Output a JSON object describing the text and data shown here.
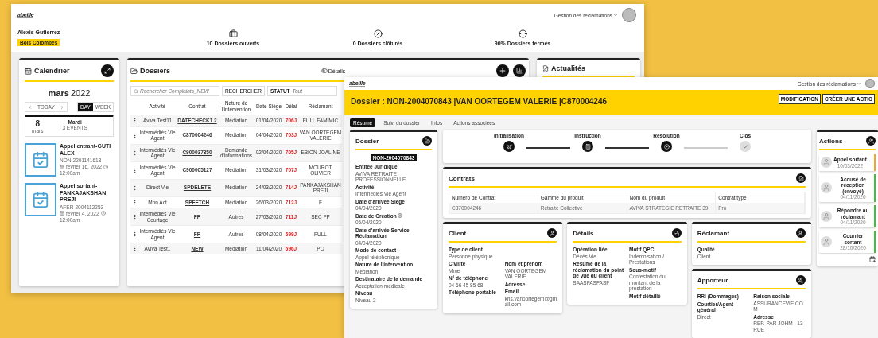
{
  "back_window": {
    "logo": "abeille",
    "menu": "Gestion des réclamations",
    "user": {
      "name": "Alexis Gutierrez",
      "site": "Bois Colombes"
    },
    "stats": [
      {
        "kind": "open",
        "text": "10 Dossiers ouverts"
      },
      {
        "kind": "closed",
        "text": "0 Dossiers",
        "note": "clôturés"
      },
      {
        "kind": "rate",
        "text": "90% Dossiers fermés"
      }
    ],
    "calendar": {
      "title": "Calendrier",
      "month": "mars",
      "year": "2022",
      "today": "TODAY",
      "views": [
        {
          "label": "DAY",
          "selected": true
        },
        {
          "label": "WEEK",
          "selected": false
        }
      ],
      "day": {
        "number": "8",
        "month": "mars",
        "weekday": "Mardi",
        "events": "3 EVENTS"
      },
      "events": [
        {
          "title": "Appel entrant-GUTI ALEX",
          "ref": "NON-2201141618",
          "date": "février 16, 2022",
          "time": "12:00am"
        },
        {
          "title": "Appel sortant-PANKAJAKSHAN PREJI",
          "ref": "AFER-2004112253",
          "date": "février 4, 2022",
          "time": "12:00am"
        }
      ]
    },
    "dossiers": {
      "title": "Dossiers",
      "toggle": "Détails",
      "search_placeholder": "Rechercher Complaints_NEW",
      "search_button": "RECHERCHER",
      "status": {
        "label": "STATUT",
        "placeholder": "Tout"
      },
      "columns": [
        {
          "label": "Activité",
          "kind": "text"
        },
        {
          "label": "Contrat",
          "kind": "code"
        },
        {
          "label": "Nature de l'intervention",
          "kind": "text"
        },
        {
          "label": "Date Siège",
          "kind": "text"
        },
        {
          "label": "Délai",
          "kind": "alert"
        },
        {
          "label": "Réclamant",
          "kind": "text"
        }
      ],
      "rows": [
        [
          "Aviva Test11",
          "DATECHECK1.2",
          "Médiation",
          "01/04/2020",
          "706J",
          "FULL FAM MIC"
        ],
        [
          "Intermédiés Vie Agent",
          "C870004246",
          "Médiation",
          "04/04/2020",
          "703J",
          "VAN OORTEGEM VALERIE"
        ],
        [
          "Intermédiés Vie Agent",
          "C900037350",
          "Demande d'informations",
          "02/04/2020",
          "705J",
          "EBION JOALINE"
        ],
        [
          "Intermédiés Vie Agent",
          "C900005127",
          "Médiation",
          "31/03/2020",
          "707J",
          "MOUROT OLIVIER"
        ],
        [
          "Direct Vie",
          "SPDELETE",
          "Médiation",
          "24/03/2020",
          "714J",
          "PANKAJAKSHAN PREJI"
        ],
        [
          "Mon Act",
          "SPFETCH",
          "Médiation",
          "26/03/2020",
          "712J",
          "F"
        ],
        [
          "Intermédiés Vie Courtage",
          "FP",
          "Autres",
          "27/03/2020",
          "711J",
          "SEC FP"
        ],
        [
          "Intermédiés Vie Agent",
          "FP",
          "Autres",
          "08/04/2020",
          "699J",
          "FULL"
        ],
        [
          "Aviva Test1",
          "NEW",
          "Médiation",
          "11/04/2020",
          "696J",
          "PO"
        ]
      ]
    },
    "news": {
      "title": "Actualités"
    }
  },
  "front_window": {
    "logo": "abeille",
    "menu": "Gestion des réclamations",
    "title": "Dossier : NON-2004070843 |VAN OORTEGEM VALERIE |C870004246",
    "buttons": [
      "MODIFICATION",
      "CRÉER UNE ACTIO"
    ],
    "tabs": [
      {
        "label": "Résumé",
        "selected": true
      },
      {
        "label": "Suivi du dossier",
        "selected": false
      },
      {
        "label": "Infos",
        "selected": false
      },
      {
        "label": "Actions associées",
        "selected": false
      }
    ],
    "dossier": {
      "title": "Dossier",
      "badge": "NON-2004070843",
      "fields": [
        {
          "label": "Entitée Juridique",
          "value": "AVIVA RETRAITE PROFESSIONNELLE"
        },
        {
          "label": "Activité",
          "value": "Intermédiés Vie Agent"
        },
        {
          "label": "Date d'arrivée Siège",
          "value": "04/04/2020"
        },
        {
          "label": "Date de Création",
          "value": "05/04/2020",
          "help": true
        },
        {
          "label": "Date d'arrivée Service Réclamation",
          "value": "04/04/2020"
        },
        {
          "label": "Mode de contact",
          "value": "Appel téléphonique"
        },
        {
          "label": "Nature de l'intervention",
          "value": "Médiation"
        },
        {
          "label": "Destinataire de la demande",
          "value": "Acceptation médicale"
        },
        {
          "label": "Niveau",
          "value": "Niveau 2"
        }
      ]
    },
    "steps": [
      {
        "label": "Initialisation",
        "kind": "init",
        "done": true
      },
      {
        "label": "Instruction",
        "kind": "instruction",
        "done": true
      },
      {
        "label": "Résolution",
        "kind": "resolution",
        "done": true
      },
      {
        "label": "Clos",
        "kind": "close",
        "done": false
      }
    ],
    "contrats": {
      "title": "Contrats",
      "columns": [
        "Numéro de Contrat",
        "Gamme du produit",
        "Nom du produit",
        "Contrat type"
      ],
      "rows": [
        [
          "C870004246",
          "Retraite Collective",
          "AVIVA STRATEGIE RETRAITE 39",
          "Pro"
        ]
      ]
    },
    "client": {
      "title": "Client",
      "top": [
        {
          "label": "Type de client",
          "value": "Personne physique"
        }
      ],
      "columns": [
        [
          {
            "label": "Civilité",
            "value": "Mme"
          },
          {
            "label": "N° de téléphone",
            "value": "04 66 45 85 68"
          },
          {
            "label": "Téléphone portable"
          }
        ],
        [
          {
            "label": "Nom et prénom",
            "value": "VAN OORTEGEM VALERIE"
          },
          {
            "label": "Adresse"
          },
          {
            "label": "Email",
            "value": "kris.vanoortegem@gmail.com"
          }
        ]
      ]
    },
    "details": {
      "title": "Détails",
      "columns": [
        [
          {
            "label": "Opération liée",
            "value": "Décès Vie"
          },
          {
            "label": "Résumé de la réclamation du point de vue du client",
            "value": "SAASFASFASF"
          }
        ],
        [
          {
            "label": "Motif QPC",
            "value": "Indemnisation / Prestations"
          },
          {
            "label": "Sous-motif",
            "value": "Contestation du montant de la prestation"
          },
          {
            "label": "Motif détaillé"
          }
        ]
      ]
    },
    "reclamant": {
      "title": "Réclamant",
      "top": [
        {
          "label": "Qualité",
          "value": "Client"
        }
      ]
    },
    "apporteur": {
      "title": "Apporteur",
      "columns": [
        [
          {
            "label": "RRI (Dommages)"
          },
          {
            "label": "Courtier/Agent général",
            "value": "Direct"
          }
        ],
        [
          {
            "label": "Raison sociale",
            "value": "ASSURANCEVIE.COM"
          },
          {
            "label": "Adresse",
            "value": "REP. PAR JOHM - 13 RUE"
          }
        ]
      ]
    },
    "actions": {
      "title": "Actions",
      "items": [
        {
          "title": "Appel sortant",
          "date": "10/03/2022",
          "color": "#f5a623"
        },
        {
          "title": "Accusé de réception (envoyé)",
          "date": "04/11/2020",
          "color": "#3cc13b"
        },
        {
          "title": "Répondre au réclamant",
          "date": "04/11/2020",
          "color": "#3cc13b"
        },
        {
          "title": "Courrier sortant",
          "date": "28/10/2020",
          "color": "#3cc13b"
        }
      ]
    }
  }
}
